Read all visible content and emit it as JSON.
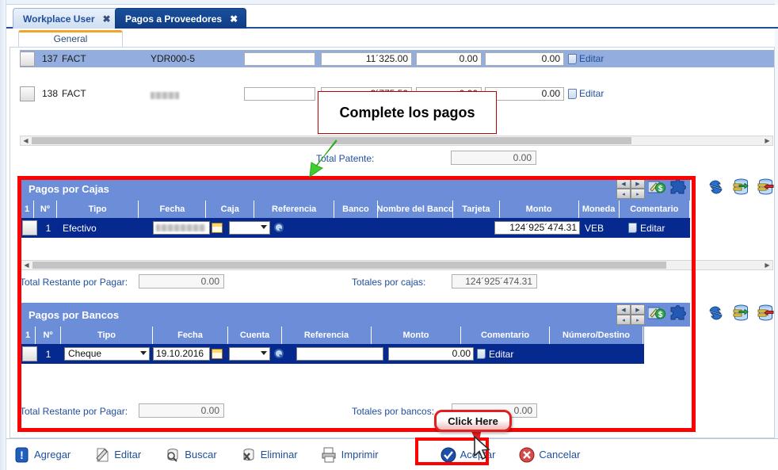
{
  "window": {
    "tabs": [
      {
        "label": "Workplace User",
        "close": "✖",
        "active": false
      },
      {
        "label": "Pagos a Proveedores",
        "close": "✖",
        "active": true
      }
    ],
    "subtab": "General"
  },
  "invoice_grid": {
    "rows": [
      {
        "num": "137",
        "type": "FACT",
        "ref": "YDR000-5",
        "ref_blurred": false,
        "empty": "",
        "monto": "11´325.00",
        "col4": "0.00",
        "col5": "0.00",
        "edit": "Editar",
        "selected": true
      },
      {
        "num": "138",
        "type": "FACT",
        "ref": "",
        "ref_blurred": true,
        "empty": "",
        "monto": "3´775.50",
        "col4": "0.00",
        "col5": "0.00",
        "edit": "Editar",
        "selected": false
      }
    ]
  },
  "annotations": {
    "complete_box": "Complete los pagos",
    "click_here": "Click Here"
  },
  "total_patente": {
    "label": "Total Patente:",
    "value": "0.00"
  },
  "cajas": {
    "title": "Pagos por Cajas",
    "columns": [
      "1",
      "Nº",
      "Tipo",
      "Fecha",
      "Caja",
      "Referencia",
      "Banco",
      "Nombre del Banco",
      "Tarjeta",
      "Monto",
      "Moneda",
      "Comentario"
    ],
    "row": {
      "num": "1",
      "tipo": "Efectivo",
      "fecha": "",
      "fecha_blurred": true,
      "caja": "",
      "referencia": "",
      "banco": "",
      "nombre_banco": "",
      "tarjeta": "",
      "monto": "124´925´474.31",
      "moneda": "VEB",
      "comentario": "Editar"
    },
    "footer": {
      "restante_label": "Total Restante por Pagar:",
      "restante_value": "0.00",
      "totales_label": "Totales por cajas:",
      "totales_value": "124´925´474.31"
    },
    "toolbar_icons": [
      "nav-first-icon",
      "nav-prev-icon",
      "nav-next-icon",
      "nav-last-icon",
      "edit-money-icon",
      "puzzle-icon",
      "refresh-icon",
      "db-insert-icon",
      "db-delete-icon"
    ]
  },
  "bancos": {
    "title": "Pagos por Bancos",
    "columns": [
      "1",
      "Nº",
      "Tipo",
      "Fecha",
      "Cuenta",
      "Referencia",
      "Monto",
      "Comentario",
      "Número/Destino"
    ],
    "row": {
      "num": "1",
      "tipo": "Cheque",
      "fecha": "19.10.2016",
      "cuenta": "",
      "referencia": "",
      "monto": "0.00",
      "comentario": "Editar",
      "numero_destino": ""
    },
    "footer": {
      "restante_label": "Total Restante por Pagar:",
      "restante_value": "0.00",
      "totales_label": "Totales por bancos:",
      "totales_value": "0.00"
    },
    "toolbar_icons": [
      "nav-first-icon",
      "nav-prev-icon",
      "nav-next-icon",
      "nav-last-icon",
      "edit-money-icon",
      "puzzle-icon",
      "refresh-icon",
      "db-insert-icon",
      "db-delete-icon"
    ]
  },
  "commandbar": [
    {
      "label": "Agregar",
      "icon": "alert-add-icon"
    },
    {
      "label": "Editar",
      "icon": "pencil-edit-icon"
    },
    {
      "label": "Buscar",
      "icon": "search-db-icon"
    },
    {
      "label": "Eliminar",
      "icon": "delete-db-icon"
    },
    {
      "label": "Imprimir",
      "icon": "printer-icon"
    },
    {
      "label": "Aceptar",
      "icon": "accept-check-icon"
    },
    {
      "label": "Cancelar",
      "icon": "cancel-x-icon"
    }
  ],
  "colors": {
    "accent_blue": "#1f4e9c",
    "row_selected": "#06298f",
    "header_blue": "#6c8ed8",
    "annotation_red": "#fe0000",
    "arrow_green": "#3ecf2e"
  }
}
